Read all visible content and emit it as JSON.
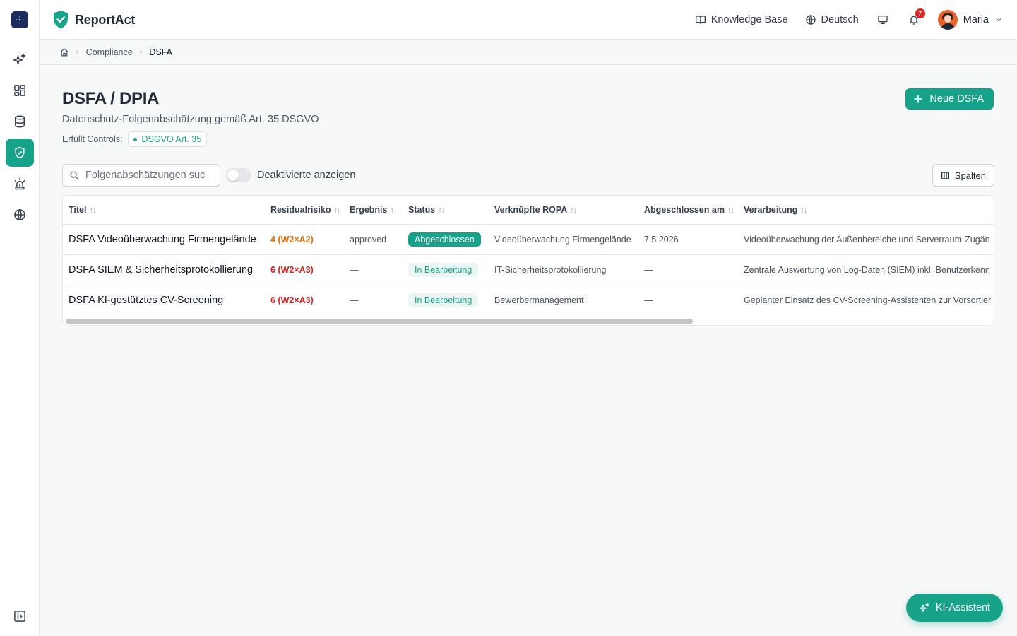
{
  "app": {
    "name": "ReportAct"
  },
  "rail": {
    "items": [
      {
        "name": "ai-sparkle",
        "active": false
      },
      {
        "name": "dashboard",
        "active": false
      },
      {
        "name": "database",
        "active": false
      },
      {
        "name": "compliance-shield",
        "active": true
      },
      {
        "name": "alarm",
        "active": false
      },
      {
        "name": "globe",
        "active": false
      }
    ]
  },
  "header": {
    "knowledge_base": "Knowledge Base",
    "language": "Deutsch",
    "notifications_count": "7",
    "user_name": "Maria"
  },
  "breadcrumb": {
    "level1": "Compliance",
    "level2": "DSFA"
  },
  "page": {
    "title": "DSFA / DPIA",
    "subtitle": "Datenschutz-Folgenabschätzung gemäß Art. 35 DSGVO",
    "controls_label": "Erfüllt Controls:",
    "control_chip": "DSGVO Art. 35",
    "new_button": "Neue DSFA"
  },
  "toolbar": {
    "search_placeholder": "Folgenabschätzungen suchen...",
    "toggle_label": "Deaktivierte anzeigen",
    "toggle_on": false,
    "columns_button": "Spalten"
  },
  "table": {
    "columns": [
      "Titel",
      "Residualrisiko",
      "Ergebnis",
      "Status",
      "Verknüpfte ROPA",
      "Abgeschlossen am",
      "Verarbeitung"
    ],
    "sort_glyph": "↑↓",
    "rows": [
      {
        "title": "DSFA Videoüberwachung Firmengelände",
        "risk": "4 (W2×A2)",
        "risk_level": "orange",
        "result": "approved",
        "status": "Abgeschlossen",
        "status_style": "solid",
        "ropa": "Videoüberwachung Firmengelände",
        "completed": "7.5.2026",
        "processing": "Videoüberwachung der Außenbereiche und Serverraum-Zugän"
      },
      {
        "title": "DSFA SIEM & Sicherheitsprotokollierung",
        "risk": "6 (W2×A3)",
        "risk_level": "red",
        "result": "—",
        "status": "In Bearbeitung",
        "status_style": "soft",
        "ropa": "IT-Sicherheitsprotokollierung",
        "completed": "—",
        "processing": "Zentrale Auswertung von Log-Daten (SIEM) inkl. Benutzerkenn"
      },
      {
        "title": "DSFA KI-gestütztes CV-Screening",
        "risk": "6 (W2×A3)",
        "risk_level": "red",
        "result": "—",
        "status": "In Bearbeitung",
        "status_style": "soft",
        "ropa": "Bewerbermanagement",
        "completed": "—",
        "processing": "Geplanter Einsatz des CV-Screening-Assistenten zur Vorsortier"
      }
    ]
  },
  "ai_assistant": {
    "label": "KI-Assistent"
  },
  "colors": {
    "accent": "#17a389",
    "risk_orange": "#ea6c0a",
    "risk_red": "#dc1f1f",
    "rail_logo": "#1e2a5a"
  }
}
